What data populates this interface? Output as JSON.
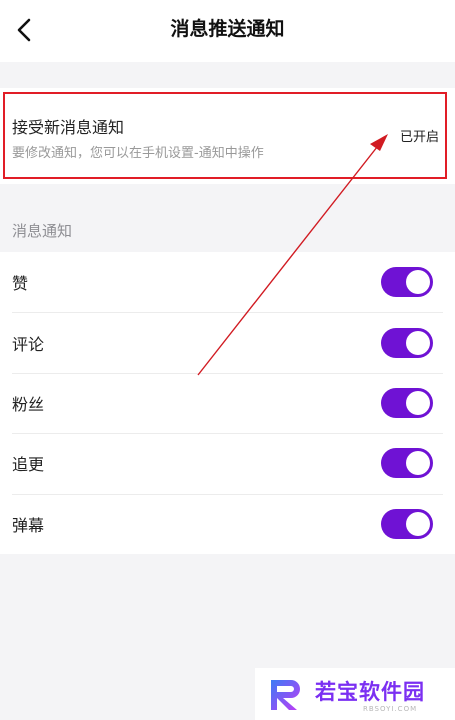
{
  "header": {
    "title": "消息推送通知",
    "back_icon": "chevron-left-icon"
  },
  "receive_notifications": {
    "title": "接受新消息通知",
    "description": "要修改通知，您可以在手机设置-通知中操作",
    "status": "已开启"
  },
  "section": {
    "label": "消息通知"
  },
  "settings": [
    {
      "label": "赞",
      "enabled": true
    },
    {
      "label": "评论",
      "enabled": true
    },
    {
      "label": "粉丝",
      "enabled": true
    },
    {
      "label": "追更",
      "enabled": true
    },
    {
      "label": "弹幕",
      "enabled": true
    }
  ],
  "watermark": {
    "text": "若宝软件园",
    "sub": "RBSOYI.COM"
  },
  "colors": {
    "accent": "#6f12d4",
    "highlight": "#e11d26",
    "background": "#f4f4f6"
  }
}
